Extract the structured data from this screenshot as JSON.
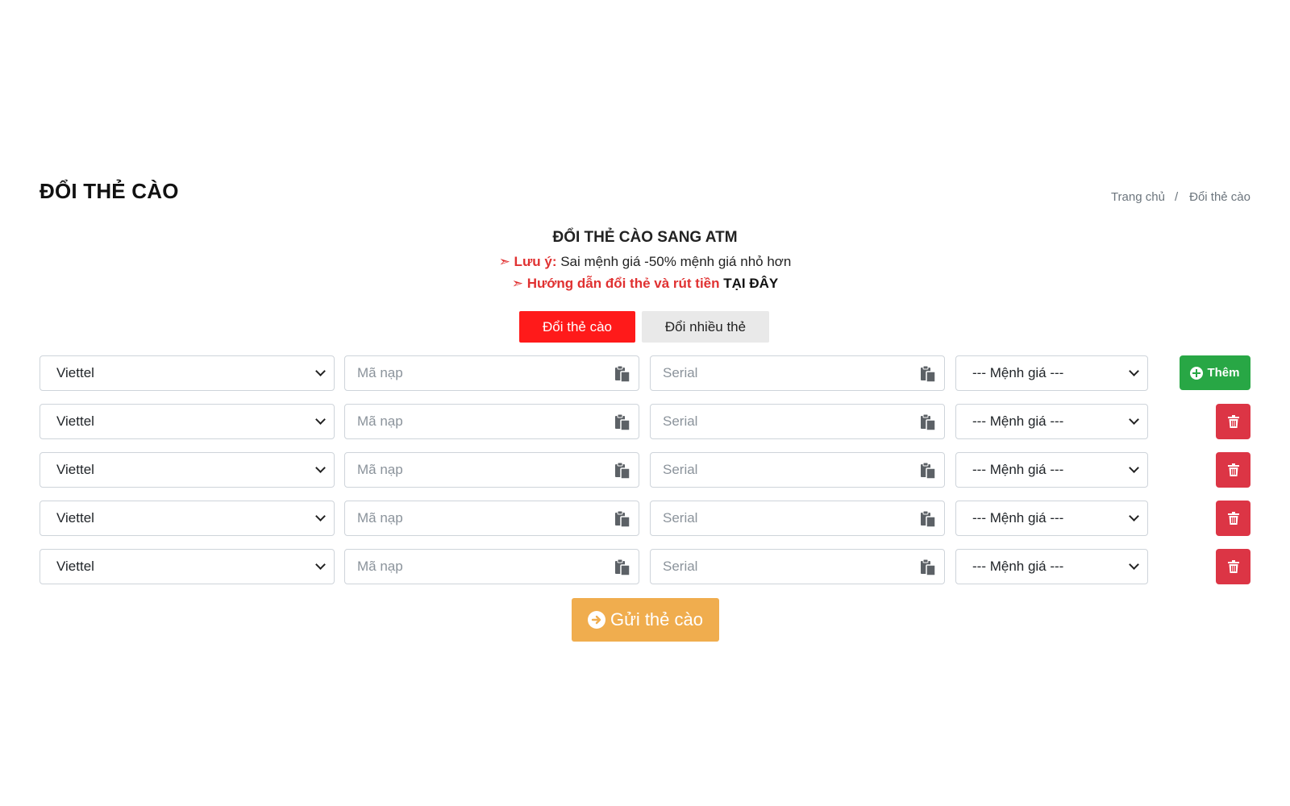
{
  "header": {
    "title": "ĐỔI THẺ CÀO",
    "breadcrumb": [
      "Trang chủ",
      "Đổi thẻ cào"
    ],
    "breadcrumb_separator": "/"
  },
  "notice": {
    "title": "ĐỔI THẺ CÀO SANG ATM",
    "line1_prefix": "➣ Lưu ý:",
    "line1_text": "Sai mệnh giá -50% mệnh giá nhỏ hơn",
    "line2_prefix": "➣ Hướng dẫn đổi thẻ và rút tiền",
    "line2_link": "TẠI ĐÂY"
  },
  "tabs": [
    {
      "label": "Đổi thẻ cào",
      "active": true
    },
    {
      "label": "Đổi nhiều thẻ",
      "active": false
    }
  ],
  "form": {
    "rows": [
      {
        "network": "Viettel",
        "code_placeholder": "Mã nạp",
        "serial_placeholder": "Serial",
        "value": "--- Mệnh giá ---",
        "action": "add"
      },
      {
        "network": "Viettel",
        "code_placeholder": "Mã nạp",
        "serial_placeholder": "Serial",
        "value": "--- Mệnh giá ---",
        "action": "delete"
      },
      {
        "network": "Viettel",
        "code_placeholder": "Mã nạp",
        "serial_placeholder": "Serial",
        "value": "--- Mệnh giá ---",
        "action": "delete"
      },
      {
        "network": "Viettel",
        "code_placeholder": "Mã nạp",
        "serial_placeholder": "Serial",
        "value": "--- Mệnh giá ---",
        "action": "delete"
      },
      {
        "network": "Viettel",
        "code_placeholder": "Mã nạp",
        "serial_placeholder": "Serial",
        "value": "--- Mệnh giá ---",
        "action": "delete"
      }
    ],
    "add_label": "Thêm",
    "submit_label": "Gửi thẻ cào"
  },
  "colors": {
    "tab_active": "#ff1a1a",
    "add_button": "#28a745",
    "delete_button": "#dc3545",
    "submit_button": "#f0ad4e",
    "notice_red": "#e03131"
  }
}
